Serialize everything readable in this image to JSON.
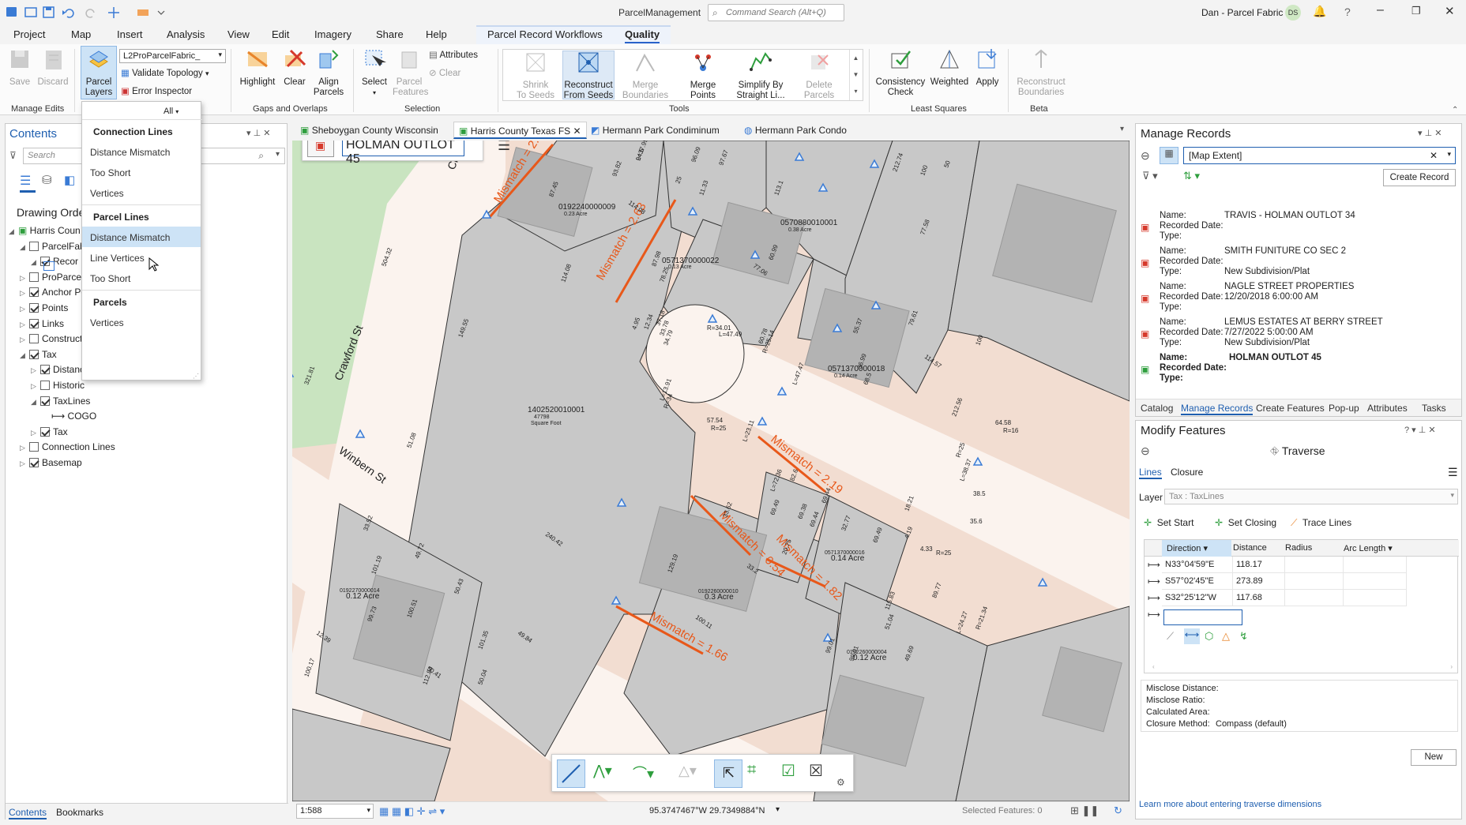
{
  "app": {
    "title": "ParcelManagement",
    "search_placeholder": "Command Search (Alt+Q)",
    "user": "Dan - Parcel Fabric",
    "user_initials": "DS"
  },
  "ribbon_tabs": [
    "Project",
    "Map",
    "Insert",
    "Analysis",
    "View",
    "Edit",
    "Imagery",
    "Share",
    "Help",
    "Parcel Record Workflows",
    "Quality"
  ],
  "ribbon": {
    "save": "Save",
    "discard": "Discard",
    "manage_edits": "Manage Edits",
    "parcel_layers": "Parcel",
    "parcel_layers2": "Layers",
    "layer_select": "L2ProParcelFabric_",
    "validate": "Validate Topology",
    "error_inspector": "Error Inspector",
    "highlight": "Highlight",
    "clear": "Clear",
    "align": "Align",
    "align2": "Parcels",
    "gaps": "Gaps and Overlaps",
    "select": "Select",
    "parcel_features": "Parcel",
    "parcel_features2": "Features",
    "attributes": "Attributes",
    "clear2": "Clear",
    "selection": "Selection",
    "shrink": "Shrink",
    "shrink2": "To Seeds",
    "reconstruct": "Reconstruct",
    "reconstruct2": "From Seeds",
    "merge_b": "Merge",
    "merge_b2": "Boundaries",
    "merge_p": "Merge",
    "merge_p2": "Points",
    "simplify": "Simplify By",
    "simplify2": "Straight Li...",
    "delete": "Delete",
    "delete2": "Parcels",
    "tools": "Tools",
    "consistency": "Consistency",
    "consistency2": "Check",
    "weighted": "Weighted",
    "apply": "Apply",
    "least_squares": "Least Squares",
    "recon_b": "Reconstruct",
    "recon_b2": "Boundaries",
    "beta": "Beta"
  },
  "dropdown": {
    "filter": "All",
    "sections": [
      {
        "head": "Connection Lines",
        "items": [
          "Distance Mismatch",
          "Too Short",
          "Vertices"
        ]
      },
      {
        "head": "Parcel Lines",
        "items": [
          "Distance Mismatch",
          "Line Vertices",
          "Too Short"
        ]
      },
      {
        "head": "Parcels",
        "items": [
          "Vertices"
        ]
      }
    ]
  },
  "contents": {
    "title": "Contents",
    "search_placeholder": "Search",
    "drawing_order": "Drawing Orde",
    "layers": [
      {
        "label": "Harris Coun",
        "indent": 0,
        "check": null,
        "exp": "◢"
      },
      {
        "label": "ParcelFabr",
        "indent": 1,
        "check": false,
        "exp": "◢"
      },
      {
        "label": "Recor",
        "indent": 2,
        "check": true,
        "exp": "◢"
      },
      {
        "label": "ProParcelF",
        "indent": 1,
        "check": false,
        "exp": "▷"
      },
      {
        "label": "Anchor Po",
        "indent": 1,
        "check": true,
        "exp": "▷"
      },
      {
        "label": "Points",
        "indent": 1,
        "check": true,
        "exp": "▷"
      },
      {
        "label": "Links",
        "indent": 1,
        "check": true,
        "exp": "▷"
      },
      {
        "label": "Construction Lines",
        "indent": 1,
        "check": false,
        "exp": "▷"
      },
      {
        "label": "Tax",
        "indent": 1,
        "check": true,
        "exp": "◢"
      },
      {
        "label": "Distance Mismatch Tax",
        "indent": 2,
        "check": true,
        "exp": "▷"
      },
      {
        "label": "Historic",
        "indent": 2,
        "check": false,
        "exp": "▷"
      },
      {
        "label": "TaxLines",
        "indent": 2,
        "check": true,
        "exp": "◢"
      },
      {
        "label": "COGO",
        "indent": 3,
        "check": null,
        "exp": ""
      },
      {
        "label": "Tax",
        "indent": 2,
        "check": true,
        "exp": "▷"
      },
      {
        "label": "Connection Lines",
        "indent": 1,
        "check": false,
        "exp": "▷"
      },
      {
        "label": "Basemap",
        "indent": 1,
        "check": true,
        "exp": "▷"
      }
    ],
    "bottom_tabs": [
      "Contents",
      "Bookmarks"
    ]
  },
  "map": {
    "tabs": [
      "Sheboygan County Wisconsin",
      "Harris County Texas FS",
      "Hermann Park Condiminum",
      "Hermann Park Condo"
    ],
    "record_name": "HOLMAN OUTLOT 45",
    "scale": "1:588",
    "coords": "95.3747467°W 29.7349884°N",
    "selected": "Selected Features: 0",
    "streets": [
      "Crawford St",
      "Crawford St",
      "Winbern St"
    ],
    "mismatches": [
      "Mismatch = 2.62",
      "Mismatch = 2.63",
      "Mismatch = 2.19",
      "Mismatch = 0.54",
      "Mismatch = 1.82",
      "Mismatch = 1.66"
    ],
    "parcels": [
      "0192240000009",
      "0.23 Acre",
      "0570880010001",
      "0.38 Acre",
      "0571370000022",
      "0.13 Acre",
      "0571370000018",
      "0.14 Acre",
      "1402520010001",
      "47798",
      "Square Foot",
      "0571370000016",
      "0.14 Acre",
      "0192260000010",
      "0.3 Acre",
      "0192270000014",
      "0.12 Acre",
      "0192260000004",
      "0.12 Acre"
    ],
    "dims": [
      "94.5",
      "96.09",
      "97.67",
      "93.82",
      "25",
      "87.45",
      "114.08",
      "11.33",
      "114.08",
      "87.98",
      "78.25",
      "77.06",
      "60.99",
      "113.1",
      "149.55",
      "504.32",
      "321.81",
      "51.08",
      "37.18",
      "33.78",
      "34.79",
      "12.34",
      "4.95",
      "R=34.01",
      "L=47.49",
      "60.78",
      "R=25.14",
      "L=47.47",
      "55.37",
      "36.99",
      "68.5",
      "79.61",
      "114.57",
      "77.58",
      "212.74",
      "100",
      "50",
      "100",
      "212.56",
      "64.58",
      "R=16",
      "L=23.11",
      "57.54",
      "R=25",
      "L=13.91",
      "R=34",
      "L=72.36",
      "69.49",
      "69.38",
      "69.44",
      "69.44",
      "32.77",
      "69.49",
      "82.6",
      "33.62",
      "20.75",
      "33.2",
      "129.19",
      "240.42",
      "100.11",
      "115.83",
      "51.04",
      "89.77",
      "R=21.34",
      "L=24.27",
      "33.52",
      "49.72",
      "50.43",
      "49.84",
      "101.19",
      "99.73",
      "100.51",
      "101.35",
      "12.39",
      "50.41",
      "112.84",
      "50.04",
      "100.17",
      "99.01",
      "99.01",
      "49.69",
      "38.5",
      "35.6",
      "R=25",
      "L=38.37",
      "18.21",
      "4.19",
      "4.33",
      "R=25",
      "L=37.99"
    ]
  },
  "manage_records": {
    "title": "Manage Records",
    "extent": "[Map Extent]",
    "create": "Create Record",
    "records": [
      {
        "name": "TRAVIS - HOLMAN OUTLOT 34",
        "date": "",
        "type": ""
      },
      {
        "name": "SMITH FUNITURE CO SEC 2",
        "date": "",
        "type": "New Subdivision/Plat"
      },
      {
        "name": "NAGLE STREET PROPERTIES",
        "date": "12/20/2018 6:00:00 AM",
        "type": ""
      },
      {
        "name": "LEMUS ESTATES AT BERRY STREET",
        "date": "7/27/2022 5:00:00 AM",
        "type": "New Subdivision/Plat"
      },
      {
        "name": "HOLMAN OUTLOT 45",
        "date": "",
        "type": ""
      }
    ],
    "labels": {
      "name": "Name:",
      "date": "Recorded Date:",
      "type": "Type:"
    },
    "tabs": [
      "Catalog",
      "Manage Records",
      "Create Features",
      "Pop-up",
      "Attributes",
      "Tasks"
    ]
  },
  "modify": {
    "title": "Modify Features",
    "tool": "Traverse",
    "subtabs": [
      "Lines",
      "Closure"
    ],
    "layer_label": "Layer",
    "layer_value": "Tax : TaxLines",
    "actions": [
      "Set Start",
      "Set Closing",
      "Trace Lines"
    ],
    "columns": [
      "Direction",
      "Distance",
      "Radius",
      "Arc Length"
    ],
    "rows": [
      [
        "N33°04'59\"E",
        "118.17",
        "",
        ""
      ],
      [
        "S57°02'45\"E",
        "273.89",
        "",
        ""
      ],
      [
        "S32°25'12\"W",
        "117.68",
        "",
        ""
      ]
    ],
    "misclose": [
      [
        "Misclose Distance:",
        ""
      ],
      [
        "Misclose Ratio:",
        ""
      ],
      [
        "Calculated Area:",
        ""
      ],
      [
        "Closure Method:",
        "Compass (default)"
      ]
    ],
    "new": "New",
    "link": "Learn more about entering traverse dimensions"
  }
}
